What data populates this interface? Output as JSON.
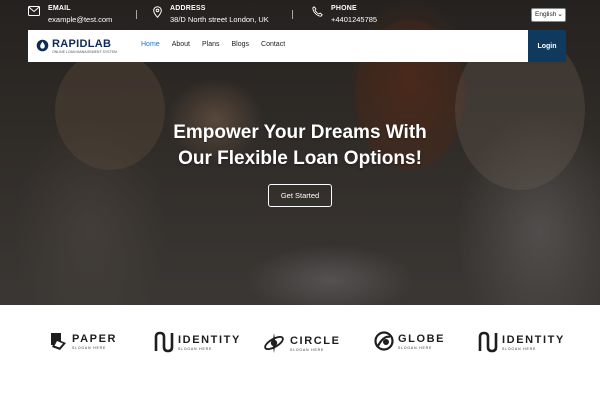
{
  "topbar": {
    "email": {
      "label": "EMAIL",
      "value": "example@test.com",
      "icon": "envelope-icon"
    },
    "address": {
      "label": "ADDRESS",
      "value": "38/D North street London, UK",
      "icon": "map-pin-icon"
    },
    "phone": {
      "label": "PHONE",
      "value": "+4401245785",
      "icon": "phone-icon"
    },
    "language": "English"
  },
  "navbar": {
    "logo_text": "RAPIDLAB",
    "logo_tagline": "ONLINE LOAN MANAGEMENT SYSTEM",
    "items": [
      {
        "label": "Home",
        "active": true
      },
      {
        "label": "About"
      },
      {
        "label": "Plans"
      },
      {
        "label": "Blogs"
      },
      {
        "label": "Contact"
      }
    ],
    "login": "Login"
  },
  "hero": {
    "headline_1": "Empower Your Dreams With",
    "headline_2": "Our Flexible Loan Options!",
    "cta": "Get Started"
  },
  "partners": [
    {
      "name": "PAPER",
      "slogan": "SLOGAN HERE",
      "icon": "paper-logo-icon"
    },
    {
      "name": "IDENTITY",
      "slogan": "SLOGAN HERE",
      "icon": "identity-logo-icon"
    },
    {
      "name": "CIRCLE",
      "slogan": "SLOGAN HERE",
      "icon": "circle-logo-icon"
    },
    {
      "name": "GLOBE",
      "slogan": "SLOGAN HERE",
      "icon": "globe-logo-icon"
    },
    {
      "name": "IDENTITY",
      "slogan": "SLOGAN HERE",
      "icon": "identity-logo-icon"
    }
  ],
  "colors": {
    "primary": "#0f3a5e",
    "active_link": "#1d74c5",
    "logo": "#0f2a55"
  }
}
